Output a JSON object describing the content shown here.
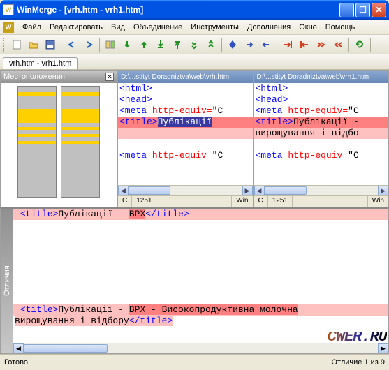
{
  "window": {
    "title": "WinMerge - [vrh.htm - vrh1.htm]"
  },
  "menu": [
    "Файл",
    "Редактировать",
    "Вид",
    "Объединение",
    "Инструменты",
    "Дополнения",
    "Окно",
    "Помощь"
  ],
  "tab": {
    "label": "vrh.htm - vrh1.htm"
  },
  "location_pane": {
    "title": "Местоположения"
  },
  "pane_left": {
    "path": "D:\\...stityt Doradniztva\\web\\vrh.htm",
    "lines": {
      "l1": "<html>",
      "l2": "<head>",
      "l3a": "<meta",
      "l3b": " http-equiv=",
      "l3c": "\"C",
      "l4a": "<title>",
      "l4b": "Публікації",
      "l6a": "<meta",
      "l6b": " http-equiv=",
      "l6c": "\"C"
    },
    "status": {
      "c": "C",
      "col": "1251",
      "mode": "Win"
    }
  },
  "pane_right": {
    "path": "D:\\...stityt Doradniztva\\web\\vrh1.htm",
    "lines": {
      "l1": "<html>",
      "l2": "<head>",
      "l3a": "<meta",
      "l3b": " http-equiv=",
      "l3c": "\"C",
      "l4a": "<title>",
      "l4b": "Публікації -",
      "l5": "вирощування і відбо",
      "l6a": "<meta",
      "l6b": " http-equiv=",
      "l6c": "\"C"
    },
    "status": {
      "c": "C",
      "col": "1251",
      "mode": "Win"
    }
  },
  "diff_detail": {
    "tab": "Отличия",
    "top": {
      "a": "<title>",
      "b": "Публікації - ",
      "c": "ВРХ",
      "d": "</title>"
    },
    "bottom": {
      "a": "<title>",
      "b": "Публікації - ",
      "c": "ВРХ - Високопродуктивна молочна",
      "d": "вирощування і відбору",
      "e": "</title>"
    },
    "watermark": "CWER.RU"
  },
  "statusbar": {
    "left": "Готово",
    "right": "Отличие 1 из 9"
  },
  "icons": {
    "new": "▢",
    "open": "📂",
    "save": "💾",
    "undo": "↶",
    "redo": "↷",
    "g1": "◫",
    "g2": "⬇",
    "g3": "⬆",
    "g4": "⤓",
    "g5": "⤒",
    "b1": "◆",
    "b2": "◇",
    "b3": "▶",
    "b4": "◀",
    "b5": "⏩",
    "b6": "⏪",
    "r1": "↔",
    "r2": "⇄",
    "r3": "⇆",
    "ref": "⟳"
  }
}
